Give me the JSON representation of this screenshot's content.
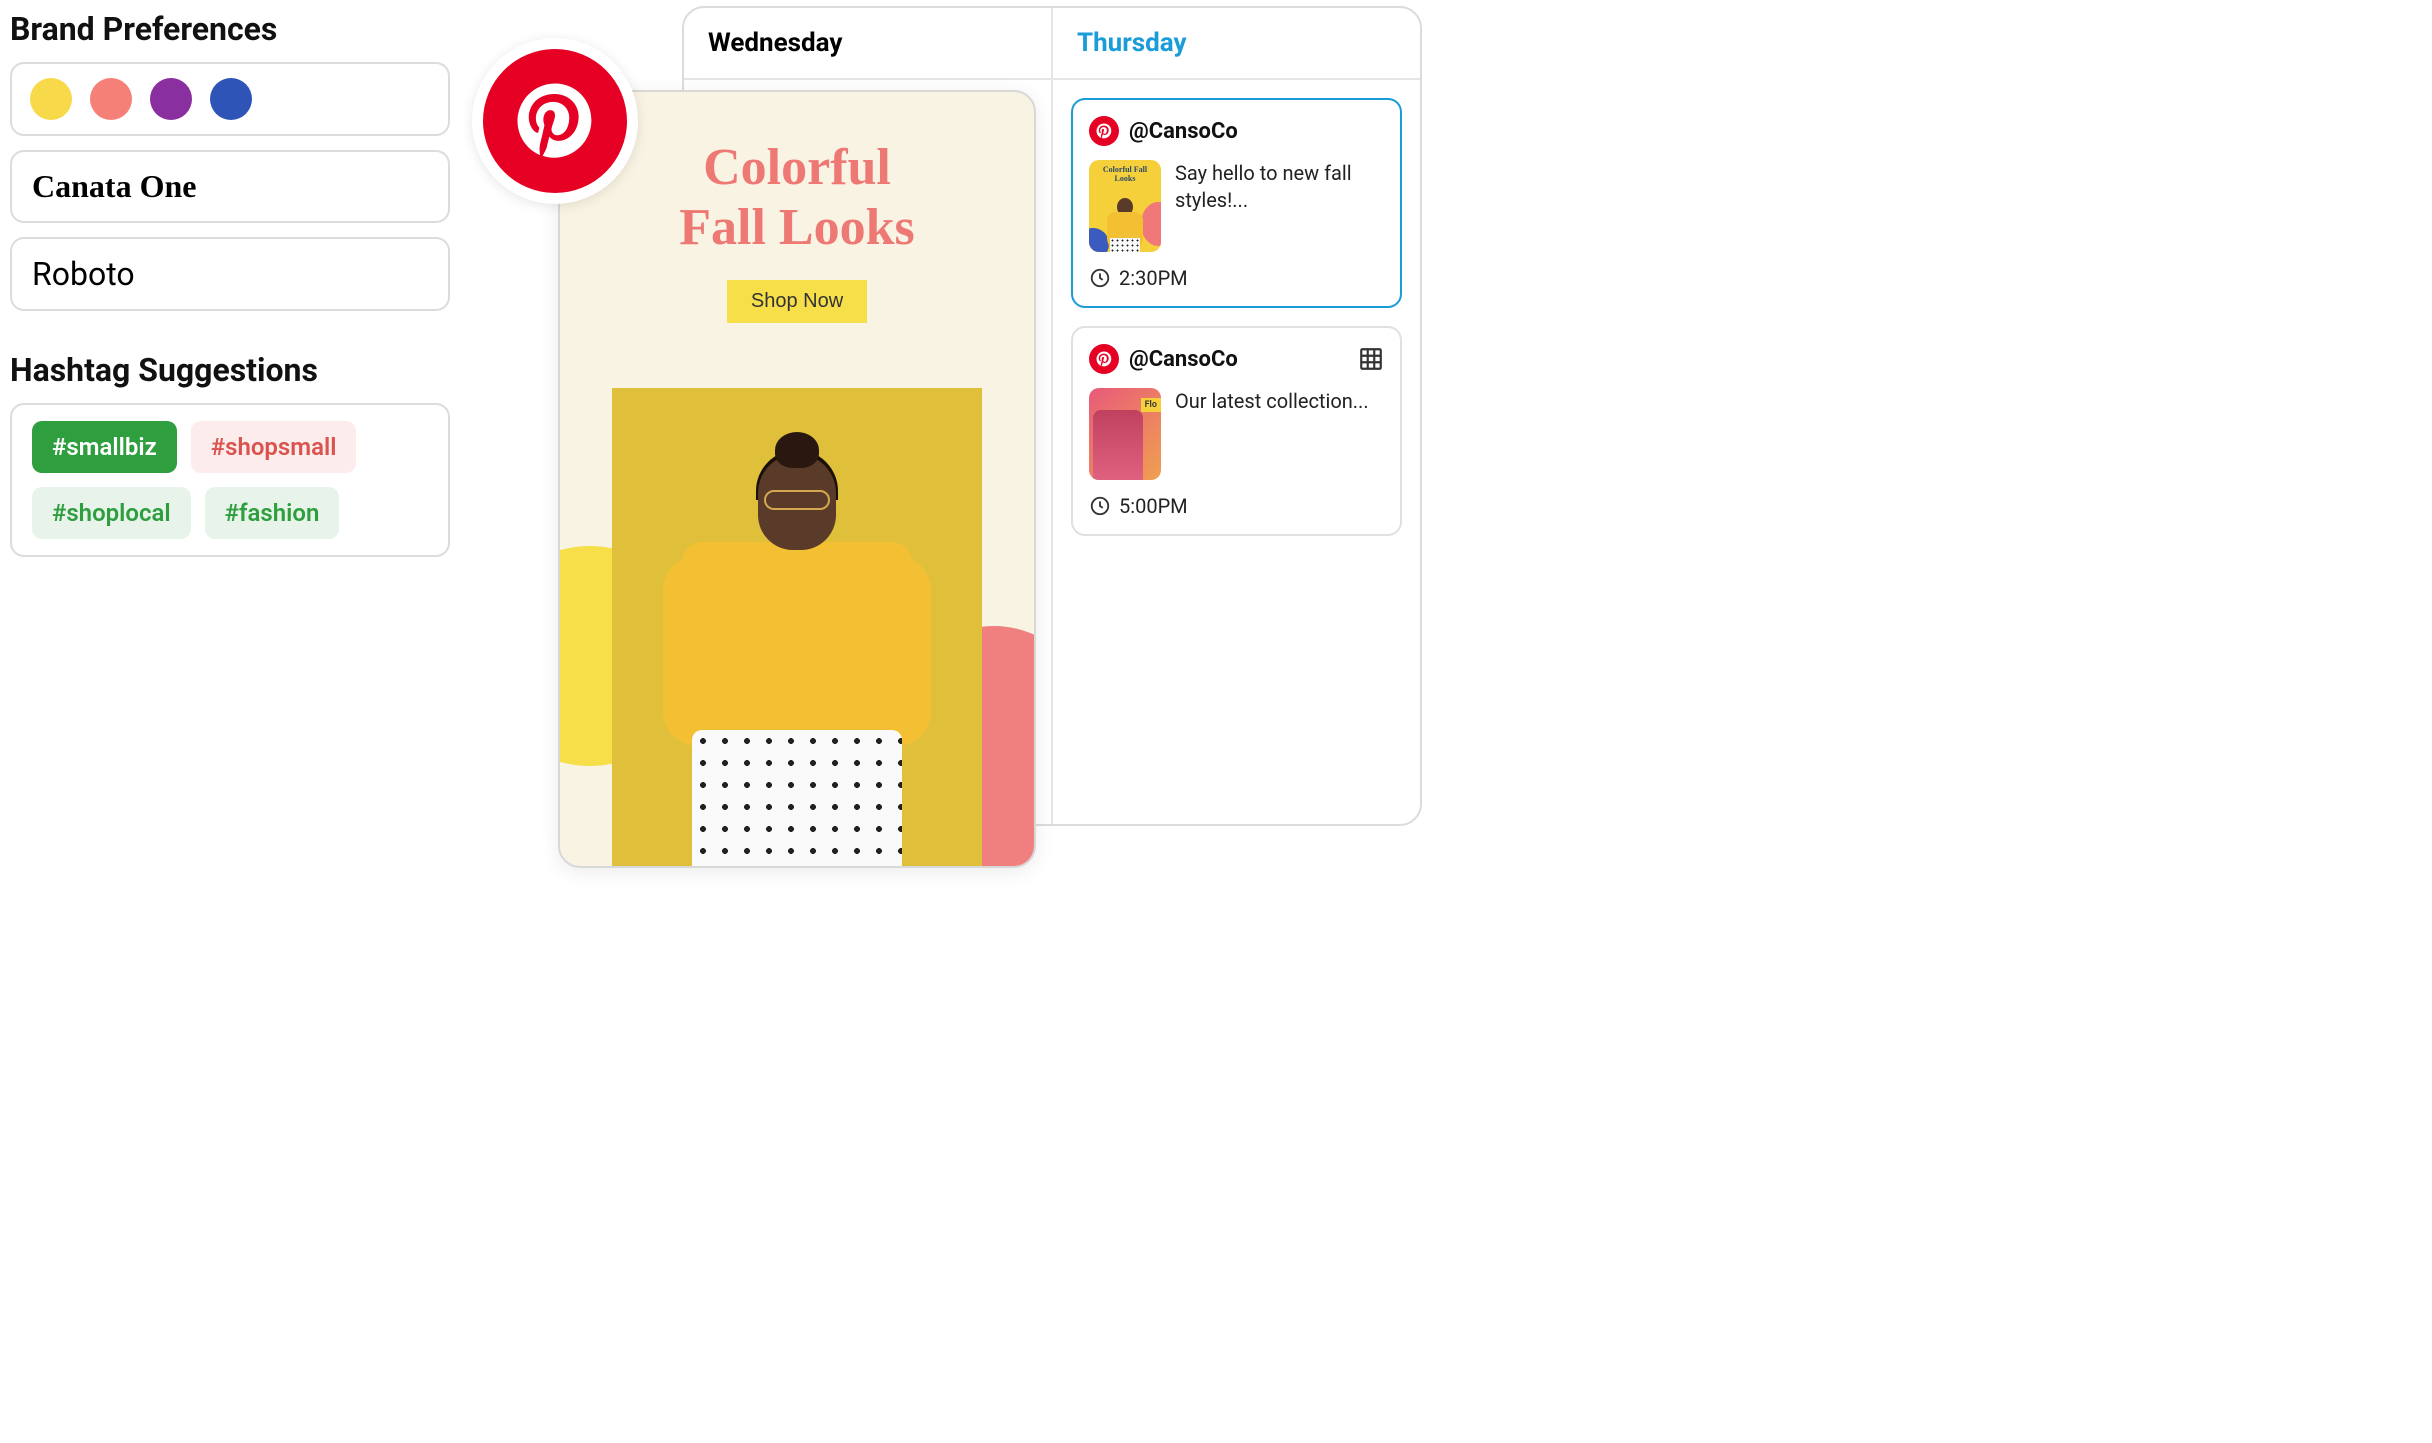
{
  "brand": {
    "heading": "Brand Preferences",
    "colors": [
      "#f7d94a",
      "#f58078",
      "#8a2fa0",
      "#2f54b8"
    ],
    "font_primary": "Canata One",
    "font_secondary": "Roboto"
  },
  "hashtags": {
    "heading": "Hashtag Suggestions",
    "items": [
      {
        "label": "#smallbiz",
        "style": "solid"
      },
      {
        "label": "#shopsmall",
        "style": "red"
      },
      {
        "label": "#shoplocal",
        "style": "light"
      },
      {
        "label": "#fashion",
        "style": "light"
      }
    ]
  },
  "pin": {
    "title_line1": "Colorful",
    "title_line2": "Fall Looks",
    "cta": "Shop Now"
  },
  "calendar": {
    "days": [
      "Wednesday",
      "Thursday"
    ],
    "active_day": "Thursday",
    "posts": [
      {
        "handle": "@CansoCo",
        "caption": "Say hello to new fall styles!...",
        "time": "2:30PM",
        "thumb_title": "Colorful Fall Looks",
        "highlighted": true
      },
      {
        "handle": "@CansoCo",
        "caption": "Our latest collection...",
        "time": "5:00PM",
        "thumb_tag": "Flo",
        "highlighted": false
      }
    ]
  }
}
